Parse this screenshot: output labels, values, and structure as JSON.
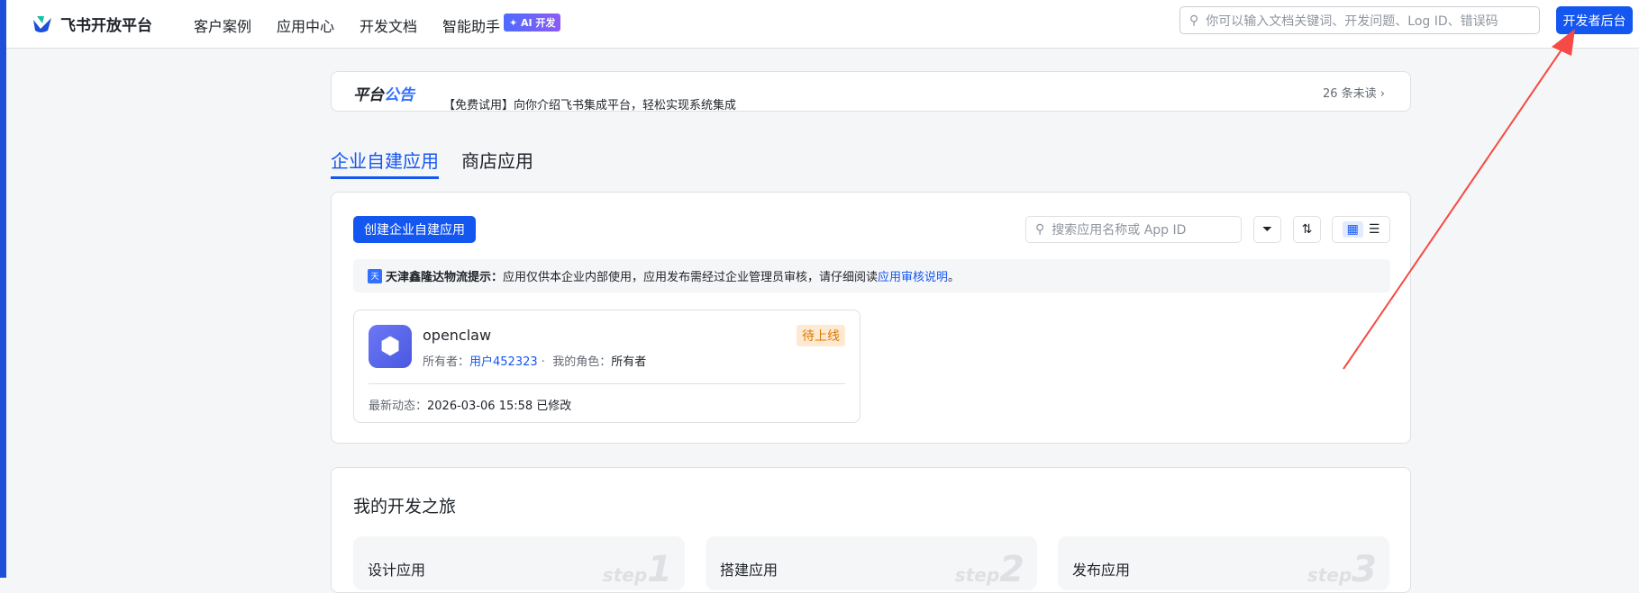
{
  "header": {
    "logo_text": "飞书开放平台",
    "nav": [
      "客户案例",
      "应用中心",
      "开发文档",
      "智能助手"
    ],
    "ai_badge": "AI 开发",
    "search_placeholder": "你可以输入文档关键词、开发问题、Log ID、错误码",
    "dev_console": "开发者后台"
  },
  "announcement": {
    "title_a": "平台",
    "title_b": "公告",
    "text": "【免费试用】向你介绍飞书集成平台，轻松实现系统集成",
    "unread": "26 条未读"
  },
  "tabs": [
    {
      "label": "企业自建应用",
      "active": true
    },
    {
      "label": "商店应用",
      "active": false
    }
  ],
  "apps": {
    "create_label": "创建企业自建应用",
    "search_placeholder": "搜索应用名称或 App ID",
    "notice_org": "天津鑫隆达物流提示：",
    "notice_text": "应用仅供本企业内部使用，应用发布需经过企业管理员审核，请仔细阅读 ",
    "notice_link": "应用审核说明",
    "notice_end": "。",
    "org_icon_char": "天",
    "items": [
      {
        "name": "openclaw",
        "status": "待上线",
        "owner_label": "所有者：",
        "owner": "用户452323",
        "role_label": "我的角色：",
        "role": "所有者",
        "activity_label": "最新动态：",
        "activity": "2026-03-06 15:58 已修改"
      }
    ]
  },
  "journey": {
    "title": "我的开发之旅",
    "steps": [
      {
        "title": "设计应用",
        "num": "1"
      },
      {
        "title": "搭建应用",
        "num": "2"
      },
      {
        "title": "发布应用",
        "num": "3"
      }
    ],
    "step_word": "step"
  },
  "colors": {
    "accent": "#1456f0",
    "status_bg": "#feead2",
    "status_fg": "#de7802",
    "annotation_arrow": "#f54a45"
  }
}
